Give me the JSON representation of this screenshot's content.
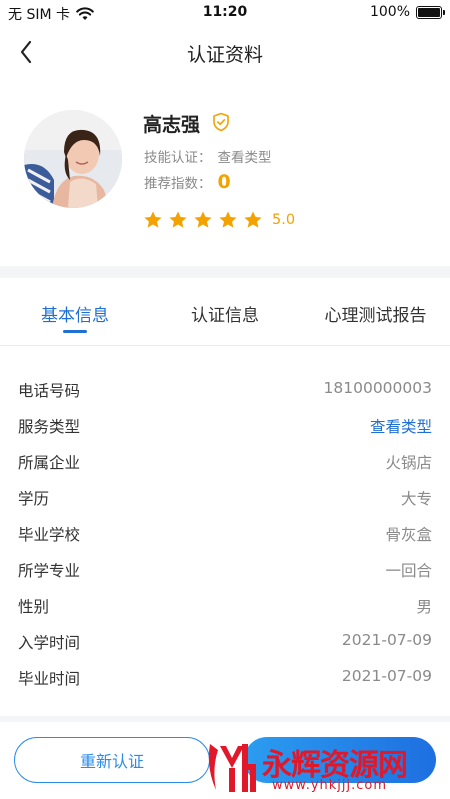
{
  "status_bar": {
    "carrier": "无 SIM 卡",
    "time": "11:20",
    "battery_text": "100%",
    "battery_level": 1.0
  },
  "nav": {
    "title": "认证资料",
    "back_icon": "chevron-left-icon"
  },
  "profile": {
    "name": "高志强",
    "verified_icon": "shield-check-icon",
    "skill_label": "技能认证：",
    "skill_link": "查看类型",
    "recommend_label": "推荐指数：",
    "recommend_value": "0",
    "rating": "5.0",
    "stars_filled": 5,
    "stars_total": 5
  },
  "tabs": [
    {
      "label": "基本信息",
      "active": true
    },
    {
      "label": "认证信息",
      "active": false
    },
    {
      "label": "心理测试报告",
      "active": false
    }
  ],
  "info": [
    {
      "label": "电话号码",
      "value": "18100000003"
    },
    {
      "label": "服务类型",
      "value": "查看类型"
    },
    {
      "label": "所属企业",
      "value": "火锅店"
    },
    {
      "label": "学历",
      "value": "大专"
    },
    {
      "label": "毕业学校",
      "value": "骨灰盒"
    },
    {
      "label": "所学专业",
      "value": "一回合"
    },
    {
      "label": "性别",
      "value": "男"
    },
    {
      "label": "入学时间",
      "value": "2021-07-09"
    },
    {
      "label": "毕业时间",
      "value": "2021-07-09"
    }
  ],
  "actions": {
    "reauth_label": "重新认证"
  },
  "watermark": {
    "text": "永辉资源网",
    "url": "www.yhkjjj.com"
  },
  "colors": {
    "accent": "#1f6fd4",
    "star": "#f3a200",
    "button_gradient_start": "#2b9df0",
    "button_gradient_end": "#1e6fe0",
    "watermark": "#e0182a"
  }
}
